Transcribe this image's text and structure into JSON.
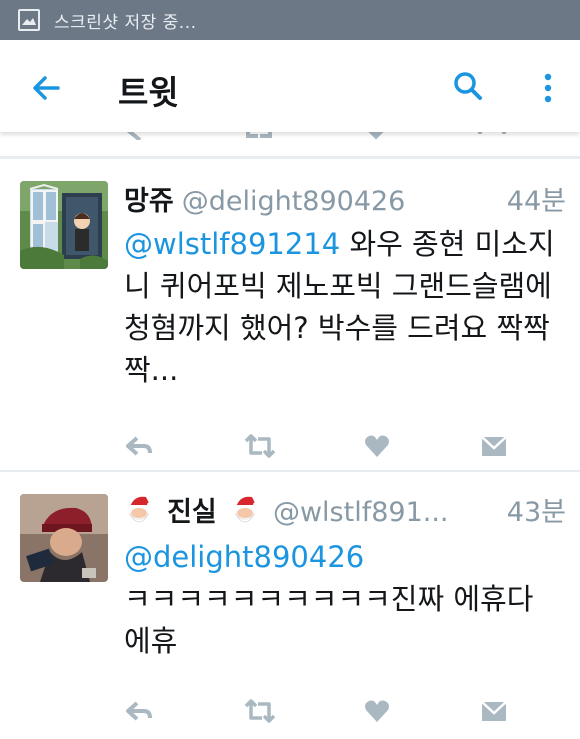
{
  "status_bar": {
    "text": "스크린샷 저장 중..."
  },
  "app_bar": {
    "title": "트윗"
  },
  "tweets": [
    {
      "name": "망쥬",
      "handle": "@delight890426",
      "time": "44분",
      "mention": "@wlstlf891214",
      "text_line1": " 와우 종현",
      "text_rest": "미소지니 퀴어포빅 제노포빅 그랜드슬램에 청혐까지 했어? 박수를 드려요 짝짝짝..."
    },
    {
      "name": "진실",
      "handle": "@wlstlf891...",
      "time": "43분",
      "mention": "@delight890426",
      "text_rest": "ㅋㅋㅋㅋㅋㅋㅋㅋㅋㅋ진짜 에휴다 에휴"
    }
  ],
  "colors": {
    "accent": "#1b95e0",
    "muted": "#8899a6",
    "action_icon": "#aab8c2",
    "status_bar": "#6d7886"
  },
  "icons": [
    "back-arrow-icon",
    "search-icon",
    "more-vert-icon",
    "reply-icon",
    "retweet-icon",
    "like-icon",
    "dm-icon",
    "santa-emoji-icon",
    "screenshot-icon"
  ]
}
